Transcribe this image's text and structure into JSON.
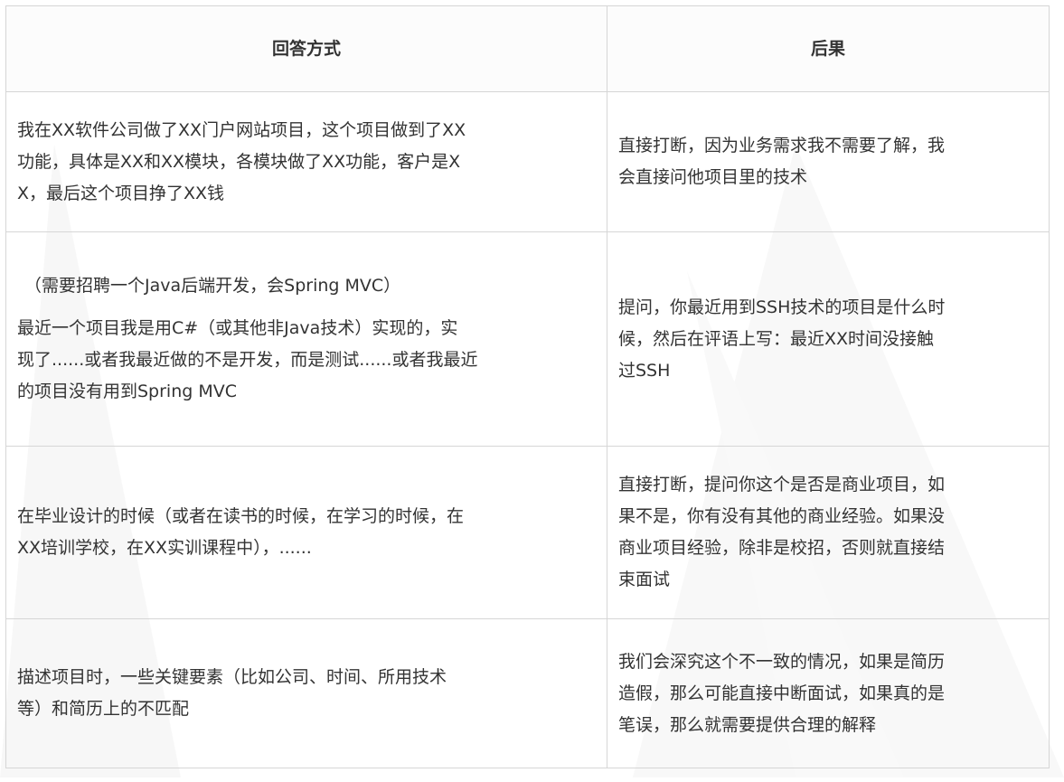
{
  "table": {
    "headers": [
      "回答方式",
      "后果"
    ],
    "rows": [
      {
        "answer": "我在XX软件公司做了XX门户网站项目，这个项目做到了XX\n功能，具体是XX和XX模块，各模块做了XX功能，客户是X\nX，最后这个项目挣了XX钱",
        "consequence": "直接打断，因为业务需求我不需要了解，我\n会直接问他项目里的技术"
      },
      {
        "context": "（需要招聘一个Java后端开发，会Spring MVC）",
        "answer": "最近一个项目我是用C#（或其他非Java技术）实现的，实\n现了......或者我最近做的不是开发，而是测试......或者我最近\n的项目没有用到Spring MVC",
        "consequence": "提问，你最近用到SSH技术的项目是什么时\n候，然后在评语上写：最近XX时间没接触\n过SSH"
      },
      {
        "answer": "在毕业设计的时候（或者在读书的时候，在学习的时候，在\nXX培训学校，在XX实训课程中），......",
        "consequence": "直接打断，提问你这个是否是商业项目，如\n果不是，你有没有其他的商业经验。如果没\n商业项目经验，除非是校招，否则就直接结\n束面试"
      },
      {
        "answer": "描述项目时，一些关键要素（比如公司、时间、所用技术\n等）和简历上的不匹配",
        "consequence": "我们会深究这个不一致的情况，如果是简历\n造假，那么可能直接中断面试，如果真的是\n笔误，那么就需要提供合理的解释"
      }
    ]
  }
}
